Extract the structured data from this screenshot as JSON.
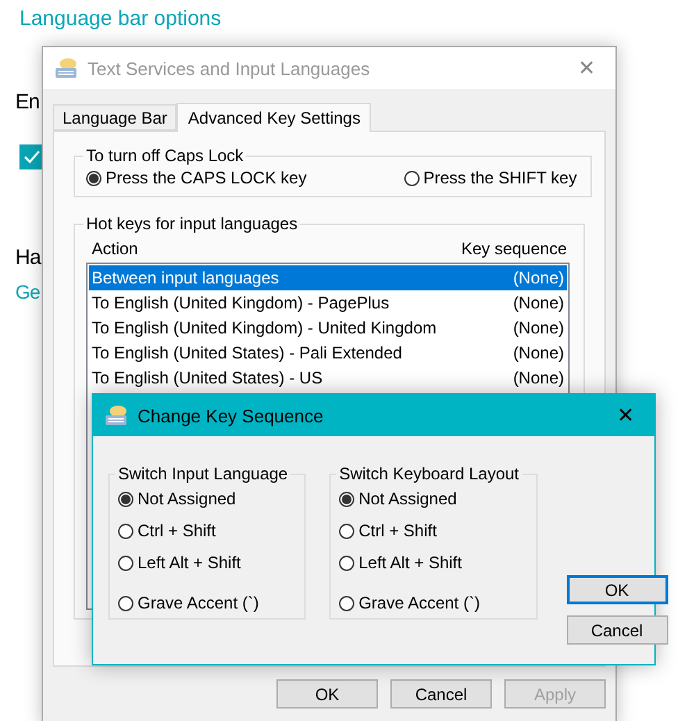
{
  "background": {
    "link": "Language bar options",
    "heading_1": "En",
    "checkbox_checked": true,
    "heading_2": "Ha",
    "link_2": "Ge"
  },
  "window": {
    "title": "Text Services and Input Languages",
    "close": "✕",
    "tabs": [
      {
        "label": "Language Bar",
        "selected": false
      },
      {
        "label": "Advanced Key Settings",
        "selected": true
      }
    ],
    "caps_group": {
      "title": "To turn off Caps Lock",
      "options": [
        {
          "label": "Press the CAPS LOCK key",
          "selected": true
        },
        {
          "label": "Press the SHIFT key",
          "selected": false
        }
      ]
    },
    "hotkeys": {
      "title": "Hot keys for input languages",
      "columns": [
        "Action",
        "Key sequence"
      ],
      "rows": [
        {
          "action": "Between input languages",
          "key": "(None)",
          "selected": true
        },
        {
          "action": "To English (United Kingdom) - PagePlus",
          "key": "(None)",
          "selected": false
        },
        {
          "action": "To English (United Kingdom) - United Kingdom",
          "key": "(None)",
          "selected": false
        },
        {
          "action": "To English (United States) - Pali Extended",
          "key": "(None)",
          "selected": false
        },
        {
          "action": "To English (United States) - US",
          "key": "(None)",
          "selected": false
        }
      ]
    },
    "buttons": [
      {
        "label": "OK",
        "disabled": false
      },
      {
        "label": "Cancel",
        "disabled": false
      },
      {
        "label": "Apply",
        "disabled": true
      }
    ]
  },
  "dialog": {
    "title": "Change Key Sequence",
    "close": "✕",
    "groups": [
      {
        "title": "Switch Input Language",
        "options": [
          {
            "label": "Not Assigned",
            "selected": true
          },
          {
            "label": "Ctrl + Shift",
            "selected": false
          },
          {
            "label": "Left Alt + Shift",
            "selected": false
          },
          {
            "label": "Grave Accent (`)",
            "selected": false
          }
        ]
      },
      {
        "title": "Switch Keyboard Layout",
        "options": [
          {
            "label": "Not Assigned",
            "selected": true
          },
          {
            "label": "Ctrl + Shift",
            "selected": false
          },
          {
            "label": "Left Alt + Shift",
            "selected": false
          },
          {
            "label": "Grave Accent (`)",
            "selected": false
          }
        ]
      }
    ],
    "buttons": [
      {
        "label": "OK",
        "focused": true
      },
      {
        "label": "Cancel",
        "focused": false
      }
    ]
  }
}
